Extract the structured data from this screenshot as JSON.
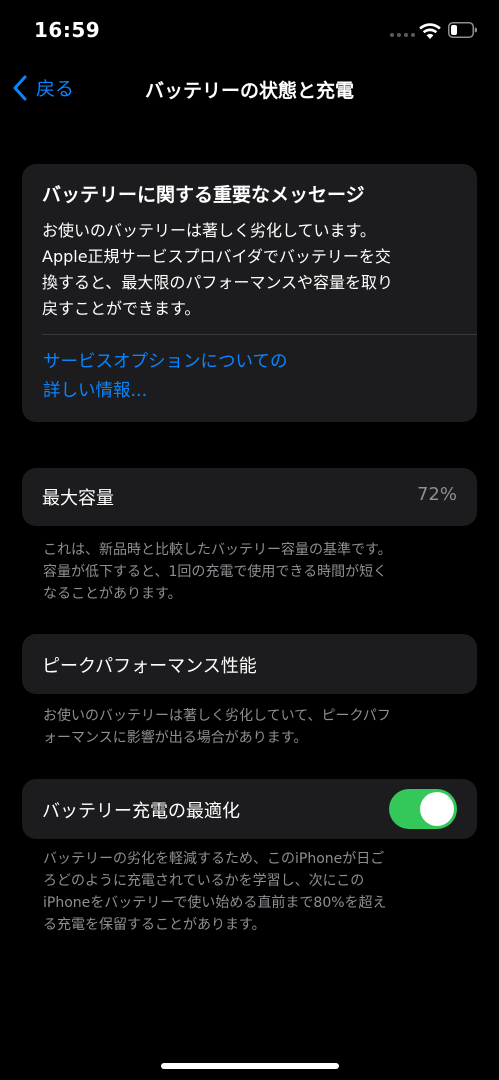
{
  "status_bar": {
    "time": "16:59"
  },
  "nav": {
    "back_label": "戻る",
    "title": "バッテリーの状態と充電"
  },
  "message_card": {
    "title": "バッテリーに関する重要なメッセージ",
    "body_lines": [
      "お使いのバッテリーは著しく劣化しています。",
      "Apple正規サービスプロバイダでバッテリーを交",
      "換すると、最大限のパフォーマンスや容量を取り",
      "戻すことができます。"
    ],
    "link_lines": [
      "サービスオプションについての",
      "詳しい情報..."
    ]
  },
  "max_capacity": {
    "label": "最大容量",
    "value": "72%",
    "footnote_lines": [
      "これは、新品時と比較したバッテリー容量の基準です。",
      "容量が低下すると、1回の充電で使用できる時間が短く",
      "なることがあります。"
    ]
  },
  "peak_performance": {
    "label": "ピークパフォーマンス性能",
    "footnote_lines": [
      "お使いのバッテリーは著しく劣化していて、ピークパフ",
      "ォーマンスに影響が出る場合があります。"
    ]
  },
  "optimized_charging": {
    "label": "バッテリー充電の最適化",
    "toggle_on": true,
    "footnote_lines": [
      "バッテリーの劣化を軽減するため、このiPhoneが日ご",
      "ろどのように充電されているかを学習し、次にこの",
      "iPhoneをバッテリーで使い始める直前まで80%を超え",
      "る充電を保留することがあります。"
    ]
  },
  "colors": {
    "background": "#000000",
    "card": "#1c1c1e",
    "accent": "#0a84ff",
    "toggle_on": "#34c759",
    "secondary_text": "#8e8e93"
  }
}
